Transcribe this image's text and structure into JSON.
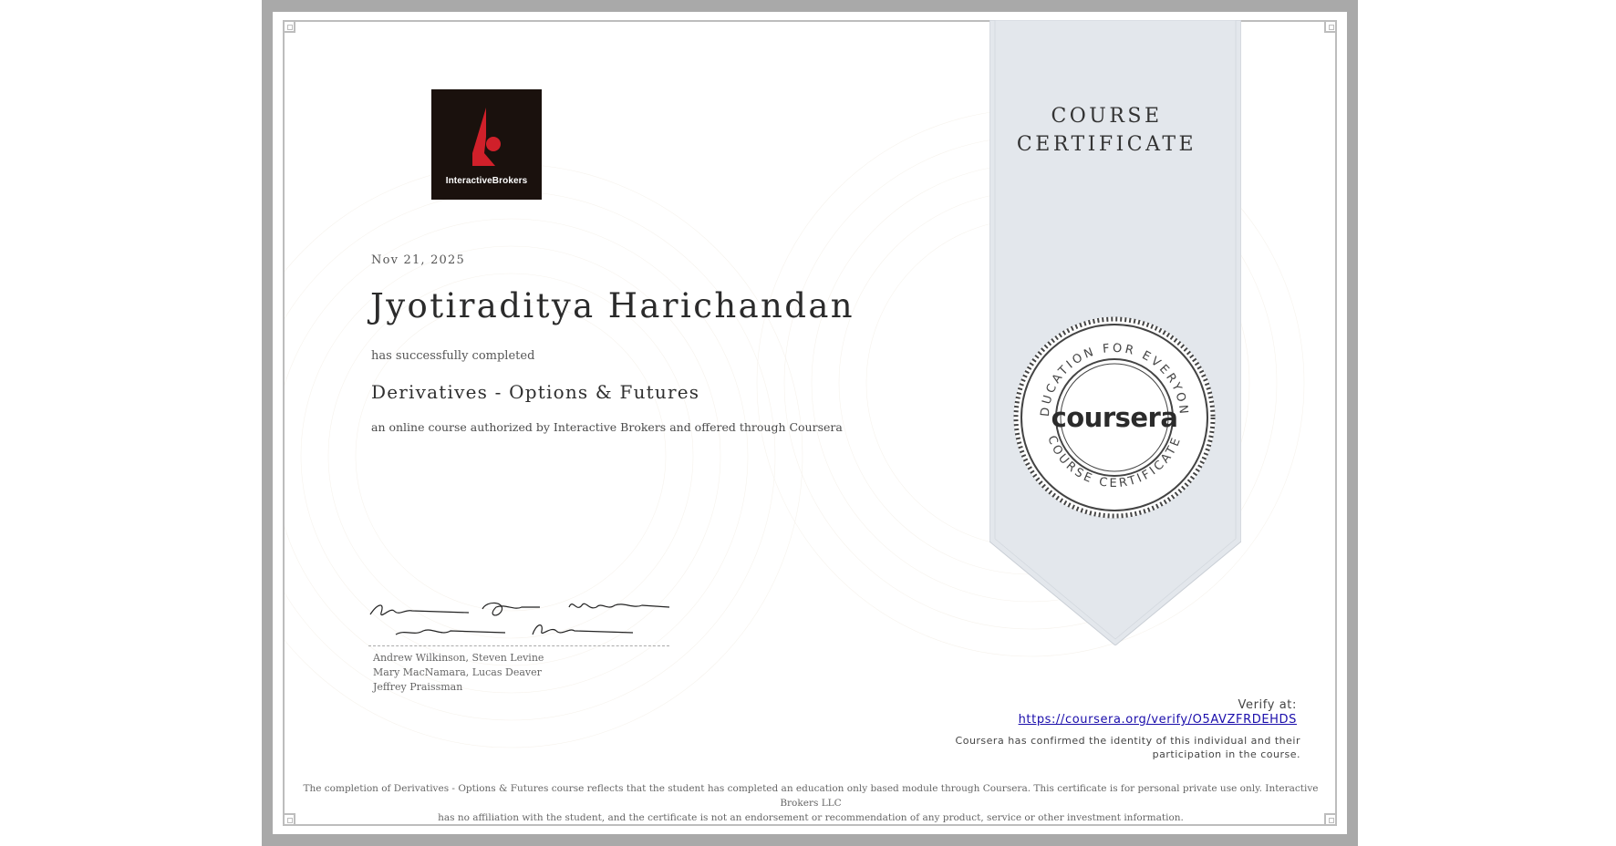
{
  "certificate": {
    "issuer_logo_text": "InteractiveBrokers",
    "date": "Nov 21, 2025",
    "recipient_name": "Jyotiraditya Harichandan",
    "completion_phrase": "has successfully completed",
    "course_name": "Derivatives - Options & Futures",
    "course_description": "an online course authorized by Interactive Brokers and offered through Coursera",
    "signers": [
      "Andrew Wilkinson, Steven Levine",
      "Mary MacNamara, Lucas Deaver",
      "Jeffrey Praissman"
    ],
    "ribbon_title_line1": "COURSE",
    "ribbon_title_line2": "CERTIFICATE",
    "seal": {
      "top_arc_text": "EDUCATION FOR EVERYONE",
      "bottom_arc_text": "COURSE CERTIFICATE",
      "wordmark": "coursera"
    },
    "verify_label": "Verify at:",
    "verify_url": "https://coursera.org/verify/O5AVZFRDEHDS",
    "confirm_line1": "Coursera has confirmed the identity of this individual and their",
    "confirm_line2": "participation in the course.",
    "disclaimer_line1": "The completion of Derivatives - Options & Futures course reflects that the student has completed an education only based module through Coursera. This certificate is for personal private use only. Interactive Brokers LLC",
    "disclaimer_line2": "has no affiliation with the student, and the certificate is not an endorsement or recommendation of any product, service or other investment information."
  },
  "colors": {
    "frame": "#a9a9a9",
    "ribbon": "#e3e7ec",
    "logo_bg": "#1a110d",
    "logo_red": "#d0202a",
    "link": "#1a0dab"
  }
}
